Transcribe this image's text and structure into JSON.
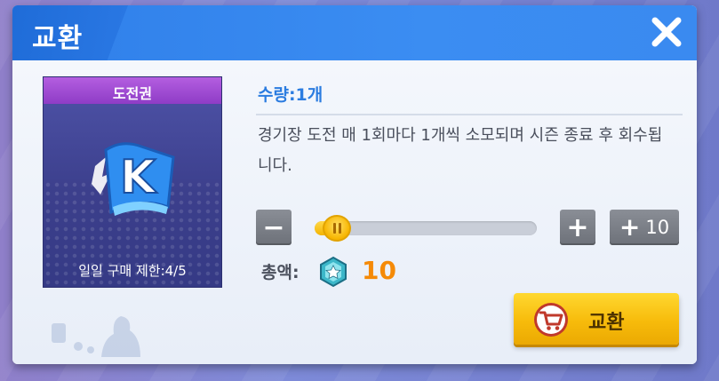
{
  "dialog": {
    "title": "교환",
    "close_icon": "close-icon"
  },
  "item": {
    "name": "도전권",
    "icon": "k-ticket-icon",
    "purchase_limit": "일일 구매 제한:4/5"
  },
  "quantity": {
    "label": "수량:1개",
    "value": 1,
    "slider_fraction": 0.1
  },
  "description": "경기장 도전 매 1회마다 1개씩 소모되며 시즌 종료 후 회수됩니다.",
  "controls": {
    "minus_label": "−",
    "plus_label": "+",
    "plus10_plus": "+",
    "plus10_value": "10"
  },
  "total": {
    "label": "총액:",
    "currency_icon": "gem-icon",
    "value": "10"
  },
  "exchange_button": {
    "label": "교환",
    "icon": "cart-icon"
  },
  "colors": {
    "title_bar": "#3a8af0",
    "accent_blue": "#2b7ce0",
    "price_orange": "#f58a07",
    "button_yellow": "#f7bb0b",
    "card_purple": "#8e3cc6"
  }
}
